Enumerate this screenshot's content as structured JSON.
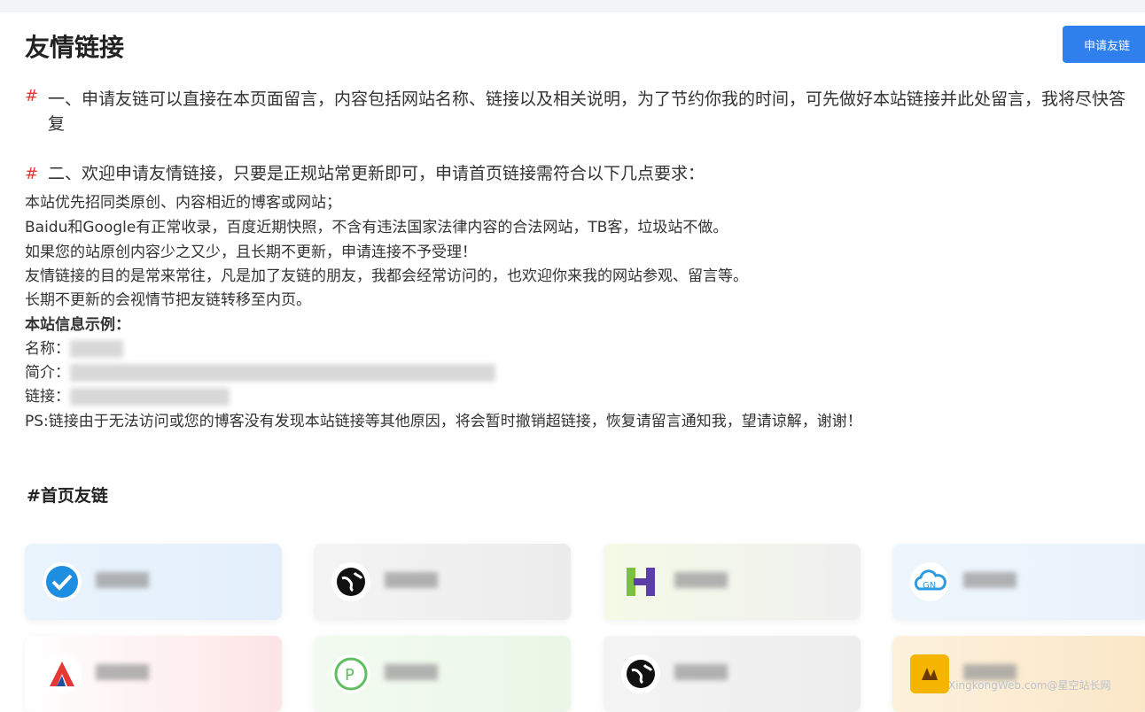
{
  "page": {
    "title": "友情链接",
    "apply_button": "申请友链"
  },
  "sections": {
    "s1_hash": "#",
    "s1_text": "一、申请友链可以直接在本页面留言，内容包括网站名称、链接以及相关说明，为了节约你我的时间，可先做好本站链接并此处留言，我将尽快答复",
    "s2_hash": "#",
    "s2_text": "二、欢迎申请友情链接，只要是正规站常更新即可，申请首页链接需符合以下几点要求："
  },
  "requirements": [
    "本站优先招同类原创、内容相近的博客或网站；",
    "Baidu和Google有正常收录，百度近期快照，不含有违法国家法律内容的合法网站，TB客，垃圾站不做。",
    "如果您的站原创内容少之又少，且长期不更新，申请连接不予受理！",
    "友情链接的目的是常来常往，凡是加了友链的朋友，我都会经常访问的，也欢迎你来我的网站参观、留言等。",
    "长期不更新的会视情节把友链转移至内页。"
  ],
  "site_info": {
    "heading": "本站信息示例：",
    "name_label": "名称：",
    "intro_label": "简介：",
    "link_label": "链接："
  },
  "ps_text": "PS:链接由于无法访问或您的博客没有发现本站链接等其他原因，将会暂时撤销超链接，恢复请留言通知我，望请谅解，谢谢！",
  "homepage_links_heading": "#首页友链",
  "watermark": "XingkongWeb.com@星空站长网",
  "colors": {
    "accent": "#2f80ed",
    "hash_red": "#e53935"
  },
  "cards": [
    {
      "icon": "blue-check-logo-icon"
    },
    {
      "icon": "globe-icon"
    },
    {
      "icon": "h-letter-logo-icon"
    },
    {
      "icon": "cloud-logo-icon"
    },
    {
      "icon": "red-a-logo-icon"
    },
    {
      "icon": "green-p-logo-icon"
    },
    {
      "icon": "globe-icon"
    },
    {
      "icon": "orange-logo-icon"
    }
  ]
}
